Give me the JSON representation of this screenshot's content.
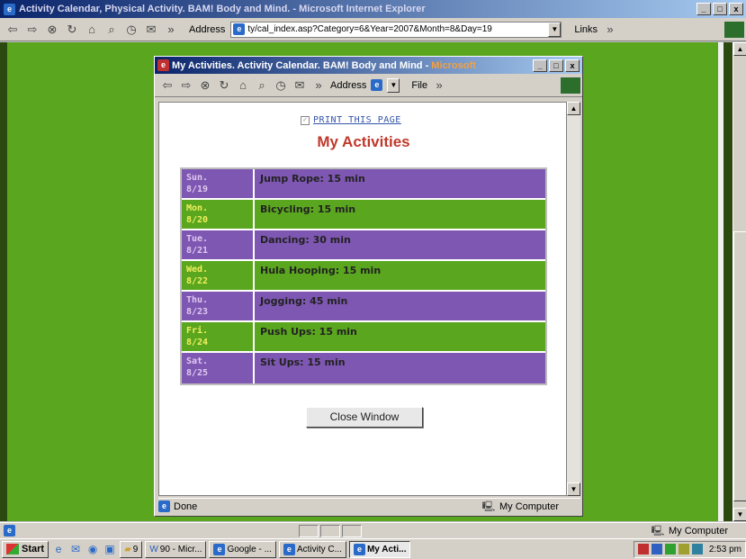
{
  "outer_window": {
    "title": "Activity Calendar, Physical Activity. BAM! Body and Mind. - Microsoft Internet Explorer",
    "address_label": "Address",
    "address_value": "ty/cal_index.asp?Category=6&Year=2007&Month=8&Day=19",
    "links_label": "Links",
    "status_text": "",
    "status_zone": "My Computer"
  },
  "popup": {
    "title_main": "My Activities. Activity Calendar. BAM! Body and Mind - ",
    "title_accent": "Microsoft",
    "address_label": "Address",
    "file_menu": "File",
    "print_label": "PRINT THIS PAGE",
    "heading": "My Activities",
    "status_done": "Done",
    "status_zone": "My Computer",
    "close_button": "Close Window",
    "activities": [
      {
        "day": "Sun.",
        "date": "8/19",
        "activity": "Jump Rope: 15 min",
        "color": "purple"
      },
      {
        "day": "Mon.",
        "date": "8/20",
        "activity": "Bicycling: 15 min",
        "color": "green"
      },
      {
        "day": "Tue.",
        "date": "8/21",
        "activity": "Dancing: 30 min",
        "color": "purple"
      },
      {
        "day": "Wed.",
        "date": "8/22",
        "activity": "Hula Hooping: 15 min",
        "color": "green"
      },
      {
        "day": "Thu.",
        "date": "8/23",
        "activity": "Jogging: 45 min",
        "color": "purple"
      },
      {
        "day": "Fri.",
        "date": "8/24",
        "activity": "Push Ups: 15 min",
        "color": "green"
      },
      {
        "day": "Sat.",
        "date": "8/25",
        "activity": "Sit Ups: 15 min",
        "color": "purple"
      }
    ]
  },
  "taskbar": {
    "start": "Start",
    "items": [
      {
        "label": "9",
        "active": false
      },
      {
        "label": "90 - Micr...",
        "active": false
      },
      {
        "label": "Google - ...",
        "active": false
      },
      {
        "label": "Activity C...",
        "active": false
      },
      {
        "label": "My Acti...",
        "active": true
      }
    ],
    "clock": "2:53 pm"
  },
  "colors": {
    "purple": "#7e57b2",
    "green": "#5aa61e",
    "heading_red": "#c0392b"
  }
}
